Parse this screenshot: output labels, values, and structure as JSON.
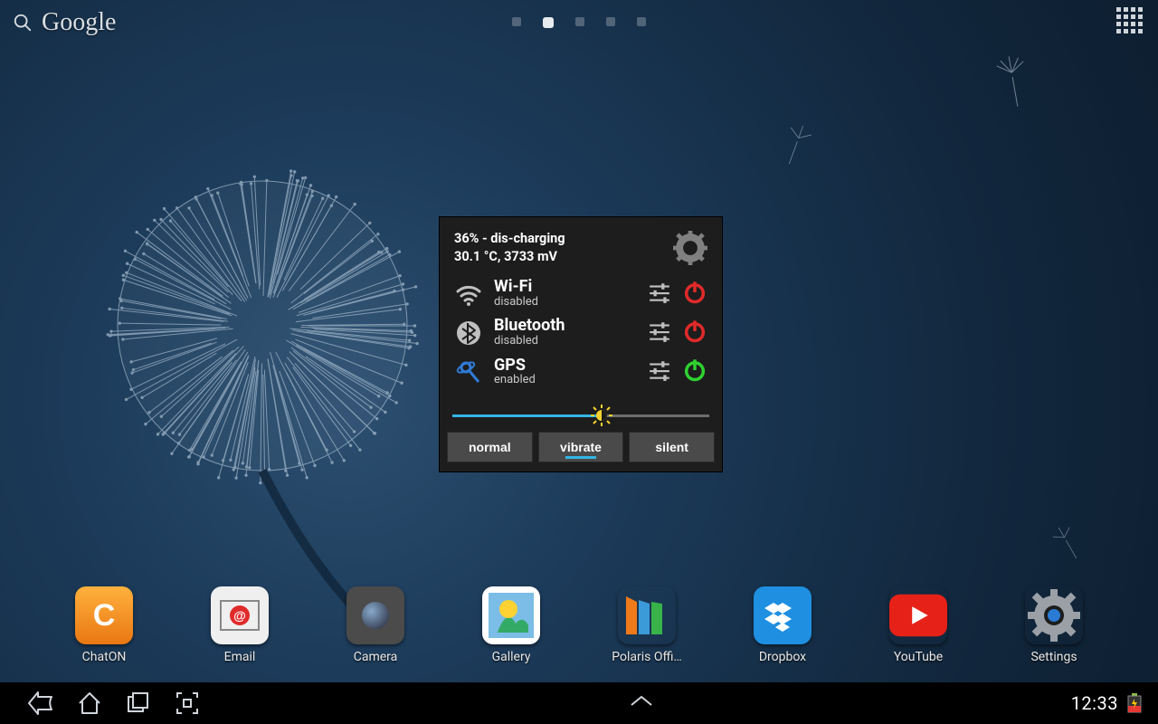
{
  "search_label": "Google",
  "home_pages": {
    "count": 5,
    "active_index": 1
  },
  "widget": {
    "battery_line1": "36% - dis-charging",
    "battery_line2": "30.1 °C, 3733 mV",
    "toggles": [
      {
        "id": "wifi",
        "title": "Wi-Fi",
        "sub": "disabled",
        "on": false
      },
      {
        "id": "bluetooth",
        "title": "Bluetooth",
        "sub": "disabled",
        "on": false
      },
      {
        "id": "gps",
        "title": "GPS",
        "sub": "enabled",
        "on": true
      }
    ],
    "brightness_percent": 58,
    "sound_modes": [
      "normal",
      "vibrate",
      "silent"
    ],
    "sound_active_index": 1
  },
  "dock": [
    {
      "id": "chaton",
      "label": "ChatON"
    },
    {
      "id": "email",
      "label": "Email"
    },
    {
      "id": "camera",
      "label": "Camera"
    },
    {
      "id": "gallery",
      "label": "Gallery"
    },
    {
      "id": "polaris",
      "label": "Polaris Offi…"
    },
    {
      "id": "dropbox",
      "label": "Dropbox"
    },
    {
      "id": "youtube",
      "label": "YouTube"
    },
    {
      "id": "settings",
      "label": "Settings"
    }
  ],
  "statusbar": {
    "time": "12:33"
  }
}
